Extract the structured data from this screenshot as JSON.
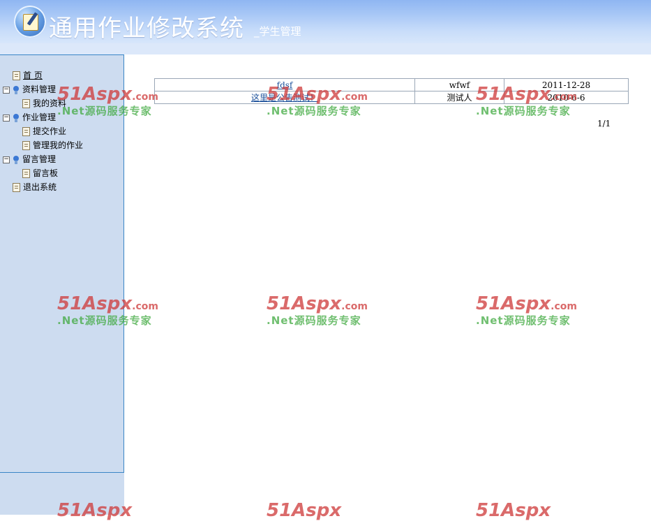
{
  "header": {
    "title": "通用作业修改系统",
    "subtitle": "_学生管理",
    "logo_icon": "notepad-pen-icon"
  },
  "sidebar": {
    "items": [
      {
        "label": "首 页",
        "icon": "page-icon"
      },
      {
        "label": "资料管理",
        "icon": "folder-node-icon",
        "expanded": true
      },
      {
        "label": "我的资料",
        "icon": "page-icon"
      },
      {
        "label": "作业管理",
        "icon": "folder-node-icon",
        "expanded": true
      },
      {
        "label": "提交作业",
        "icon": "page-icon"
      },
      {
        "label": "管理我的作业",
        "icon": "page-icon"
      },
      {
        "label": "留言管理",
        "icon": "folder-node-icon",
        "expanded": true
      },
      {
        "label": "留言板",
        "icon": "page-icon"
      },
      {
        "label": "退出系统",
        "icon": "page-icon"
      }
    ]
  },
  "notices": {
    "rows": [
      {
        "title": "fdsf",
        "author": "wfwf",
        "date": "2011-12-28"
      },
      {
        "title": "这里是公告测试！",
        "author": "测试人",
        "date": "2010-6-6"
      }
    ],
    "pager": "1/1"
  },
  "watermark": {
    "brand": "51Aspx",
    "domain": ".com",
    "slogan": ".Net源码服务专家"
  },
  "colors": {
    "header_gradient_top": "#8fb6f2",
    "sidebar_bg": "#cddcf0",
    "sidebar_border": "#3a86c6",
    "link": "#1a4f9a"
  }
}
